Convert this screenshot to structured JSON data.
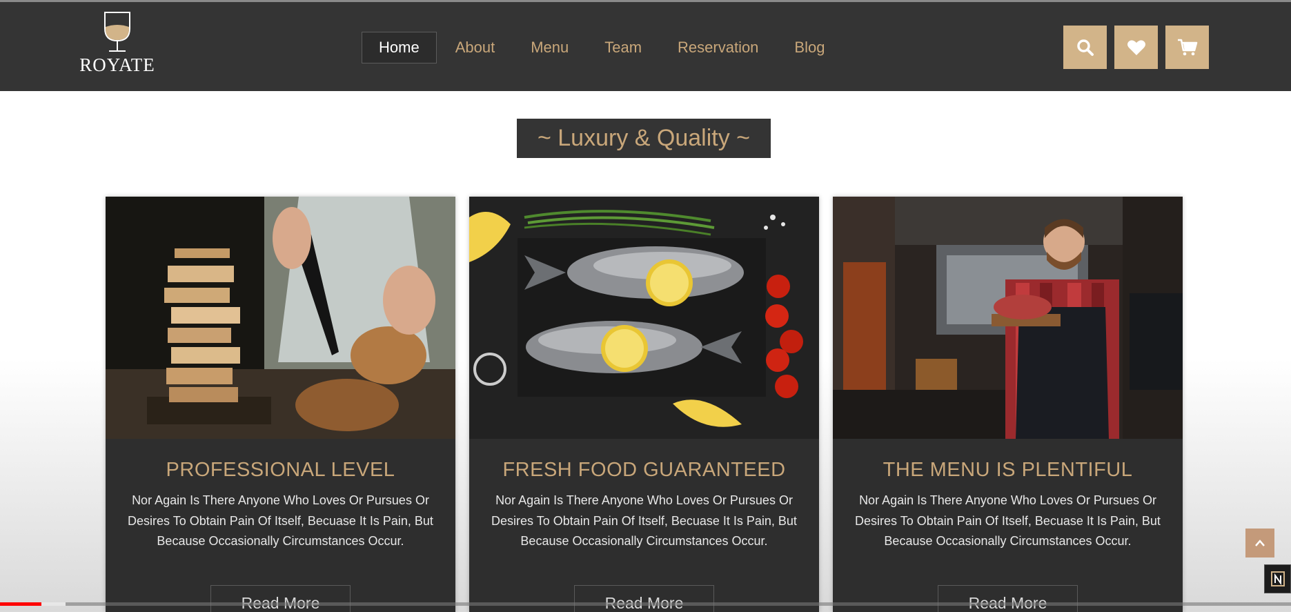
{
  "brand": {
    "name": "ROYATE",
    "logo_icon": "wine-glass-icon"
  },
  "nav": {
    "items": [
      {
        "label": "Home",
        "active": true
      },
      {
        "label": "About",
        "active": false
      },
      {
        "label": "Menu",
        "active": false
      },
      {
        "label": "Team",
        "active": false
      },
      {
        "label": "Reservation",
        "active": false
      },
      {
        "label": "Blog",
        "active": false
      }
    ],
    "icons": [
      "search-icon",
      "heart-icon",
      "cart-icon"
    ]
  },
  "section": {
    "title": "~ Luxury & Quality ~"
  },
  "cards": [
    {
      "title": "PROFESSIONAL LEVEL",
      "text": "Nor Again Is There Anyone Who Loves Or Pursues Or Desires To Obtain Pain Of Itself, Becuase It Is Pain, But Because Occasionally Circumstances Occur.",
      "button": "Read More",
      "image": "chef-cutting-bread-photo"
    },
    {
      "title": "FRESH FOOD GUARANTEED",
      "text": "Nor Again Is There Anyone Who Loves Or Pursues Or Desires To Obtain Pain Of Itself, Becuase It Is Pain, But Because Occasionally Circumstances Occur.",
      "button": "Read More",
      "image": "fish-with-lemon-photo"
    },
    {
      "title": "THE MENU IS PLENTIFUL",
      "text": "Nor Again Is There Anyone Who Loves Or Pursues Or Desires To Obtain Pain Of Itself, Becuase It Is Pain, But Because Occasionally Circumstances Occur.",
      "button": "Read More",
      "image": "chef-holding-meat-photo"
    }
  ],
  "video_player": {
    "played_fraction": 0.032,
    "buffered_fraction": 0.051
  },
  "colors": {
    "accent": "#c9a77a",
    "button_gold": "#d2b489",
    "nav_bg": "#343434",
    "card_bg": "#2e2e2e",
    "progress_red": "#ff0000"
  }
}
